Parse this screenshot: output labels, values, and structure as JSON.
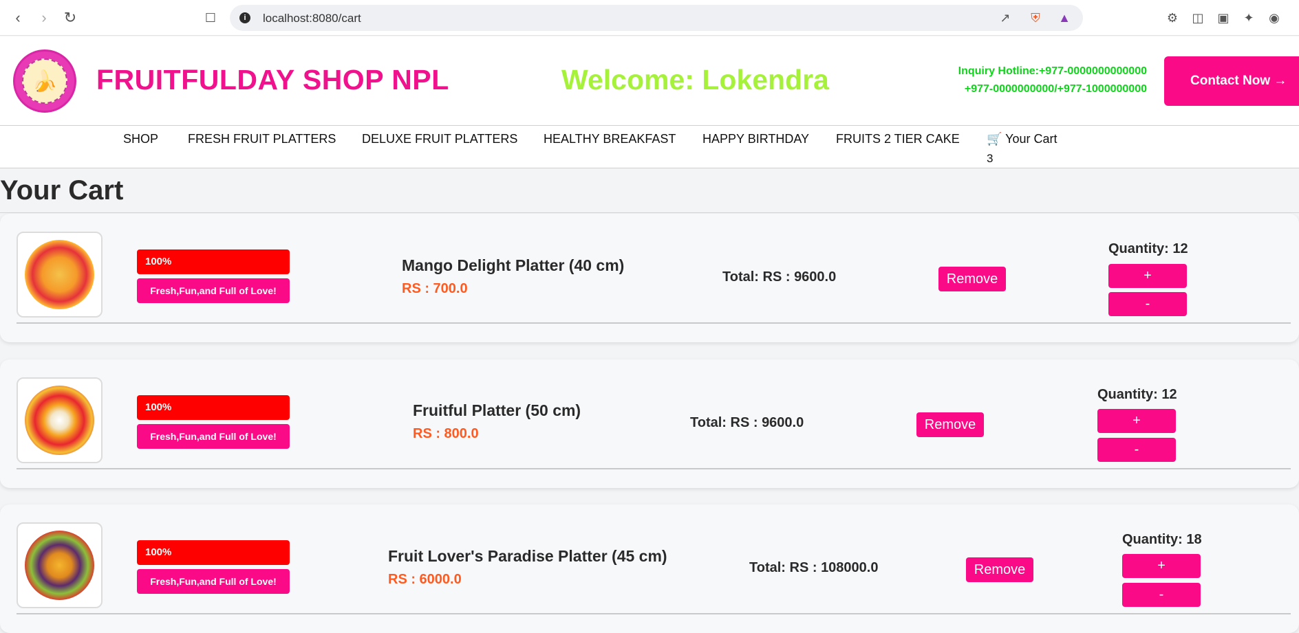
{
  "browser": {
    "url": "localhost:8080/cart"
  },
  "header": {
    "brand": "FRUITFULDAY SHOP NPL",
    "welcome": "Welcome: Lokendra",
    "hotline_line1": "Inquiry Hotline:+977-0000000000000",
    "hotline_line2": "+977-0000000000/+977-1000000000",
    "contact_label": "Contact Now →"
  },
  "nav": {
    "items": [
      "SHOP",
      "FRESH FRUIT PLATTERS",
      "DELUXE FRUIT PLATTERS",
      "HEALTHY BREAKFAST",
      "HAPPY BIRTHDAY",
      "FRUITS 2 TIER CAKE"
    ],
    "cart_label": "Your Cart",
    "cart_count": "3"
  },
  "page": {
    "title": "Your Cart"
  },
  "cart": {
    "badge_percent": "100%",
    "badge_tagline": "Fresh,Fun,and Full of Love!",
    "remove_label": "Remove",
    "plus_label": "+",
    "minus_label": "-",
    "items": [
      {
        "name": "Mango Delight Platter (40 cm)",
        "price": "RS : 700.0",
        "total": "Total: RS : 9600.0",
        "quantity": "Quantity: 12"
      },
      {
        "name": "Fruitful Platter (50 cm)",
        "price": "RS : 800.0",
        "total": "Total: RS : 9600.0",
        "quantity": "Quantity: 12"
      },
      {
        "name": "Fruit Lover's Paradise Platter (45 cm)",
        "price": "RS : 6000.0",
        "total": "Total: RS : 108000.0",
        "quantity": "Quantity: 18"
      }
    ]
  },
  "colors": {
    "brand_pink": "#f0128c",
    "button_pink": "#fa0a87",
    "welcome_green": "#a6f23a",
    "hotline_green": "#12d21e",
    "price_orange": "#ff5a1f",
    "badge_red": "#ff0000"
  }
}
